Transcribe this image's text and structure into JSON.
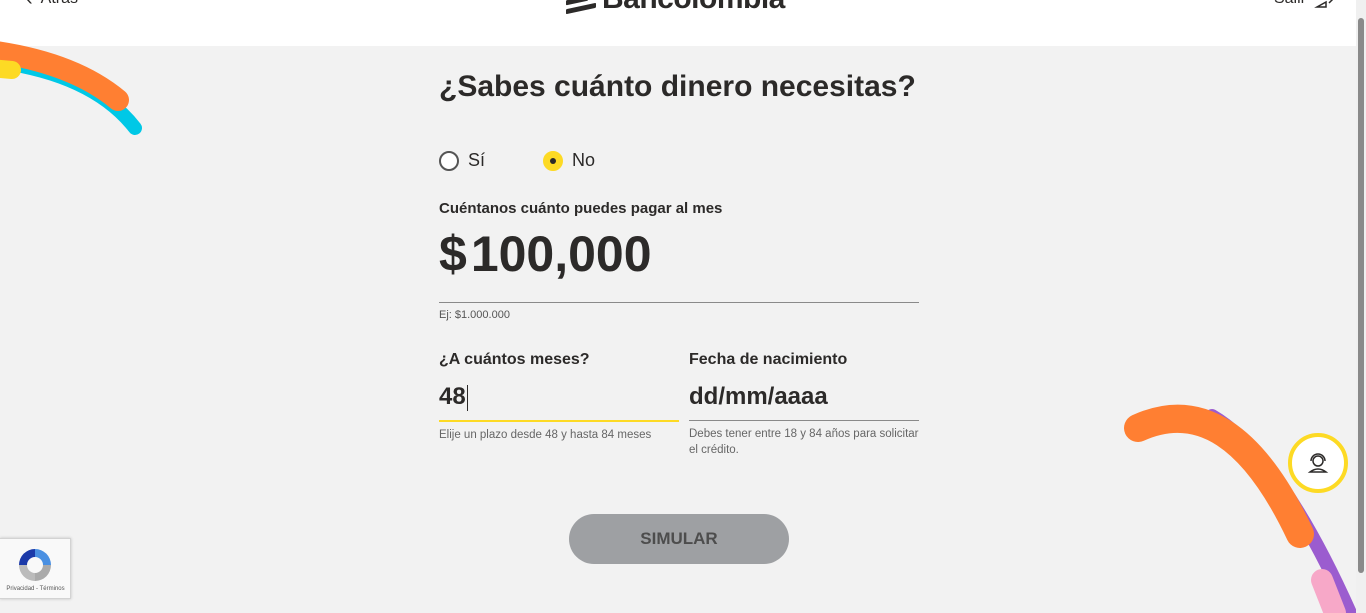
{
  "header": {
    "back_label": "Atrás",
    "brand": "Bancolombia",
    "exit_label": "Salir"
  },
  "form": {
    "title": "¿Sabes cuánto dinero necesitas?",
    "radio_options": [
      {
        "label": "Sí",
        "selected": false
      },
      {
        "label": "No",
        "selected": true
      }
    ],
    "payment_label": "Cuéntanos cuánto puedes pagar al mes",
    "payment_symbol": "$",
    "payment_value": "100,000",
    "payment_hint": "Ej: $1.000.000",
    "months_label": "¿A cuántos meses?",
    "months_value": "48",
    "months_help": "Elije un plazo desde 48 y hasta 84 meses",
    "birth_label": "Fecha de nacimiento",
    "birth_placeholder": "dd/mm/aaaa",
    "birth_help": "Debes tener entre 18 y 84 años para solicitar el crédito.",
    "submit_label": "SIMULAR"
  },
  "recaptcha": {
    "footer": "Privacidad - Términos"
  },
  "colors": {
    "accent": "#fdda24",
    "background": "#f2f2f2",
    "button_disabled": "#9ea0a3",
    "deco_orange": "#ff7f32",
    "deco_cyan": "#00c8e6",
    "deco_purple": "#9b5ccf",
    "deco_pink": "#f7a8c8"
  },
  "icons": {
    "back": "chevron-left-icon",
    "exit": "exit-door-icon",
    "assist": "agent-headset-icon",
    "recaptcha": "recaptcha-logo-icon"
  }
}
